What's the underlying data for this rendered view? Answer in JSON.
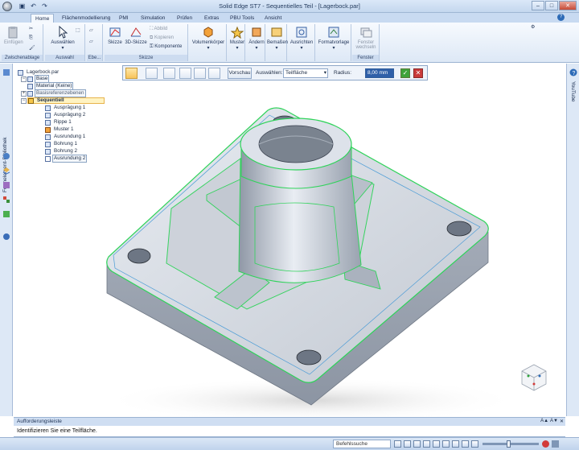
{
  "window": {
    "title": "Solid Edge ST7 - Sequentielles Teil - [Lagerbock.par]",
    "minimize": "–",
    "maximize": "□",
    "close": "✕"
  },
  "quick_access": [
    "save",
    "undo",
    "redo"
  ],
  "tabs": [
    {
      "label": "Home",
      "active": true
    },
    {
      "label": "Flächenmodellierung"
    },
    {
      "label": "PMI"
    },
    {
      "label": "Simulation"
    },
    {
      "label": "Prüfen"
    },
    {
      "label": "Extras"
    },
    {
      "label": "PBU Tools"
    },
    {
      "label": "Ansicht"
    }
  ],
  "ribbon": {
    "groups": {
      "clipboard": "Zwischenablage",
      "select": "Auswahl",
      "planes": "Ebe...",
      "sketch": "Skizze",
      "window": "Fenster"
    },
    "buttons": {
      "paste": "Einfügen",
      "select": "Auswählen",
      "sketch": "Skizze",
      "sketch3d": "3D-Skizze",
      "project": "Abbild",
      "copy": "Kopieren",
      "component": "Komponente",
      "solids": "Volumenkörper",
      "pattern": "Muster",
      "modify": "Ändern",
      "dimension": "Bemaßen",
      "align": "Ausrichten",
      "style": "Formatvorlage",
      "switch_window": "Fenster wechseln"
    }
  },
  "left_panel": {
    "label": "Formelement-Bibliothek"
  },
  "right_panel": {
    "label": "YouTube"
  },
  "command_bar": {
    "preview": "Vorschau",
    "select_label": "Auswählen:",
    "select_value": "Teilfläche",
    "radius_label": "Radius:",
    "radius_value": "8,00 mm",
    "ok": "✓",
    "cancel": "✕"
  },
  "tree": {
    "root": "Lagerbock.par",
    "base": "Base",
    "material": "Material (Keine)",
    "ref_planes": "Basisreferenzebenen",
    "sequential": "Sequentiell",
    "features": [
      "Ausprägung 1",
      "Ausprägung 2",
      "Rippe 1",
      "Muster 1",
      "Ausrundung 1",
      "Bohrung 1",
      "Bohrung 2",
      "Ausrundung 2"
    ]
  },
  "prompt": {
    "title": "Aufforderungsleiste",
    "message": "Identifizieren Sie eine Teilfläche.",
    "font_up": "A▲",
    "font_down": "A▼",
    "close": "✕"
  },
  "status": {
    "command_search": "Befehlssuche"
  },
  "colors": {
    "model_face": "#c9ced6",
    "highlight_edge": "#2fd35a",
    "selection_blue": "#2f5fa8"
  }
}
